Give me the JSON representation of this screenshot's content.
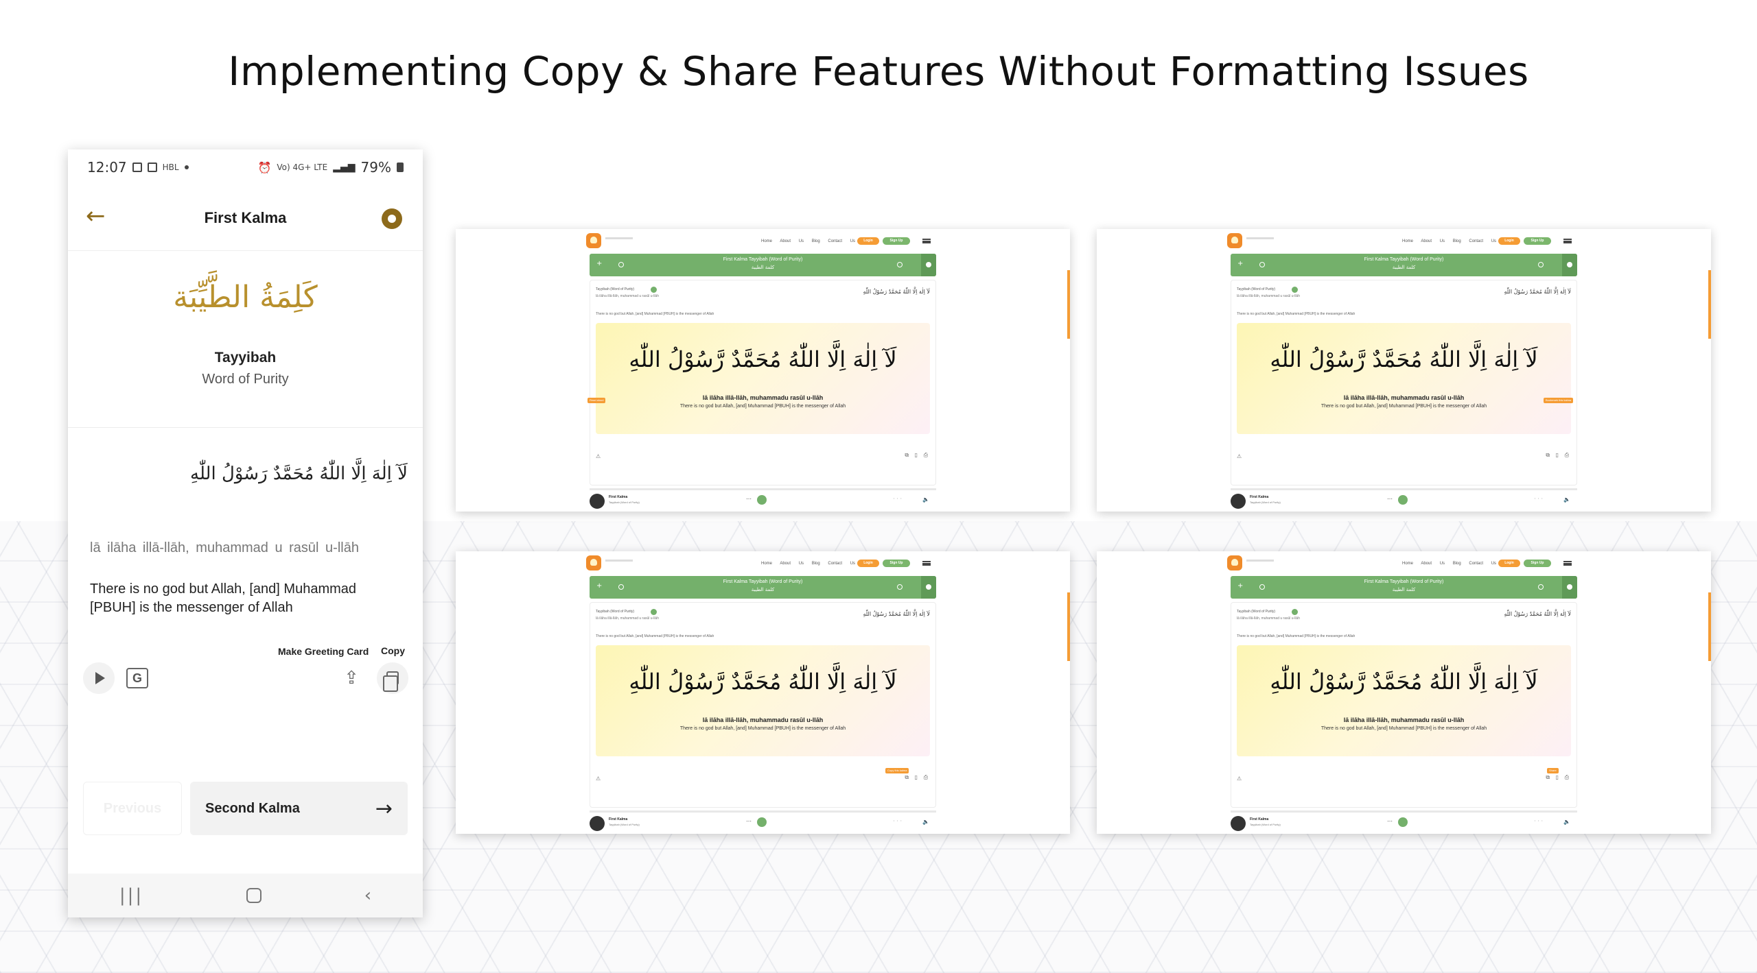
{
  "headline": "Implementing Copy & Share Features Without Formatting Issues",
  "phone": {
    "status": {
      "time": "12:07",
      "carrier": "HBL",
      "network": "Vo) 4G+ LTE",
      "battery": "79%"
    },
    "header": {
      "title": "First Kalma"
    },
    "kalma": {
      "calligraphy": "كَلِمَةُ الطَّيِّبَة",
      "name": "Tayyibah",
      "subtitle": "Word of Purity",
      "arabic": "لَآ اِلٰهَ اِلَّا اللّٰهُ مُحَمَّدٌ رَسُوْلُ اللّٰهِ",
      "transliteration": "lā  ilāha  illā-llāh,  muhammad u rasūl  u-llāh",
      "translation": "There is no god but Allah, [and] Muhammad [PBUH] is the messenger of Allah"
    },
    "actions": {
      "greeting_label": "Make Greeting Card",
      "copy_label": "Copy"
    },
    "nav": {
      "previous": "Previous",
      "next": "Second Kalma"
    }
  },
  "web": {
    "nav_links": "Home About Us Blog Contact Us",
    "login": "Login",
    "signup": "Sign Up",
    "banner_title": "First Kalma Tayyibah (Word of Purity)",
    "banner_arabic": "كلمة الطيبة",
    "card_label": "Tayyibah (Word of Purity)",
    "card_translit": "lā  ilāha  illā-llāh,  muhammad u rasūl  u-llāh",
    "card_arabic_small": "لَآ اِلٰهَ اِلَّا اللّٰهُ مُحَمَّدٌ رَسُوْلُ اللّٰهِ",
    "card_translation": "There is no god but Allah, [and] Muhammad [PBUH] is the messenger of Allah",
    "big_arabic": "لَآ اِلٰهَ اِلَّا اللّٰهُ مُحَمَّدٌ رَّسُوْلُ اللّٰهِ",
    "big_translit": "lā ilāha illā-llāh, muhammadu rasūl u-llāh",
    "big_translation": "There is no god but Allah, [and] Muhammad [PBUH] is the messenger of Allah",
    "player_name": "First Kalma",
    "player_sub": "Tayyibah (Word of Purity)",
    "badges": [
      "Read aloud",
      "Bookmark this kalma",
      "Copy this kalma",
      "Share"
    ]
  },
  "colors": {
    "accent_gold": "#8d6a1b",
    "green": "#74b06b",
    "orange": "#f59c34"
  }
}
